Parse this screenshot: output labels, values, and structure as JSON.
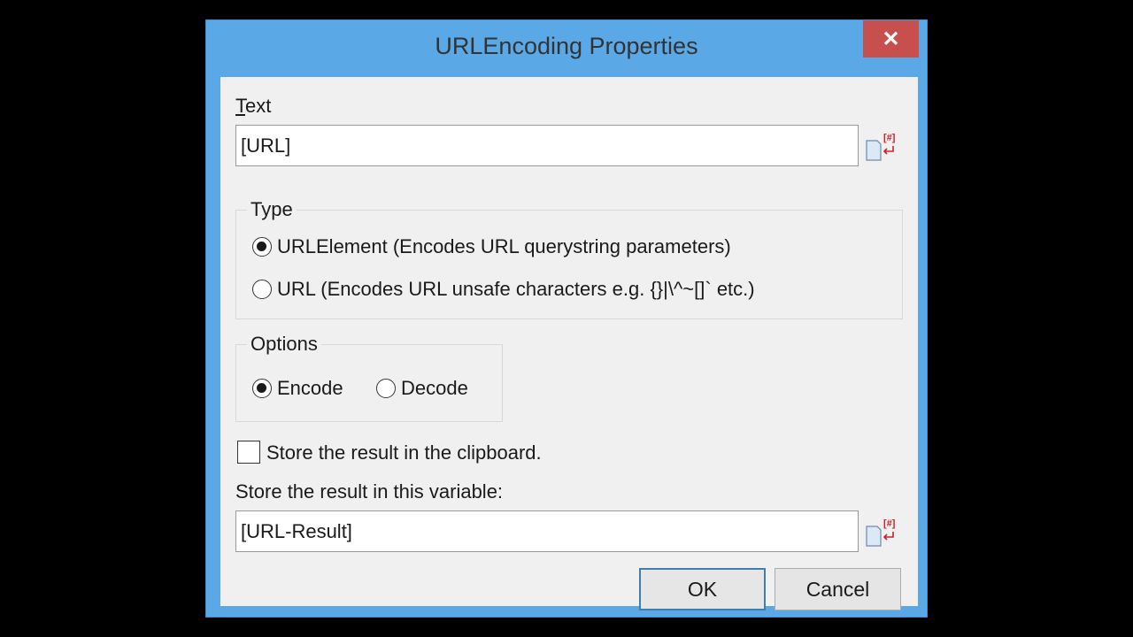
{
  "window": {
    "title": "URLEncoding Properties",
    "close_glyph": "✕",
    "accent_color": "#5aa9e6",
    "close_color": "#c7504f"
  },
  "text_field": {
    "label": "Text",
    "label_access_key": "T",
    "label_rest": "ext",
    "value": "[URL]",
    "insert_variable_icon": "insert-variable-icon"
  },
  "type_group": {
    "title": "Type",
    "options": [
      {
        "label": "URLElement (Encodes URL querystring parameters)",
        "selected": true
      },
      {
        "label": "URL (Encodes URL unsafe characters e.g. {}|\\^~[]` etc.)",
        "selected": false
      }
    ]
  },
  "options_group": {
    "title": "Options",
    "options": [
      {
        "label": "Encode",
        "selected": true
      },
      {
        "label": "Decode",
        "selected": false
      }
    ]
  },
  "clipboard": {
    "label": "Store the result in the clipboard.",
    "checked": false
  },
  "result_variable": {
    "label": "Store the result in this variable:",
    "value": "[URL-Result]",
    "insert_variable_icon": "insert-variable-icon"
  },
  "buttons": {
    "ok": "OK",
    "cancel": "Cancel"
  }
}
